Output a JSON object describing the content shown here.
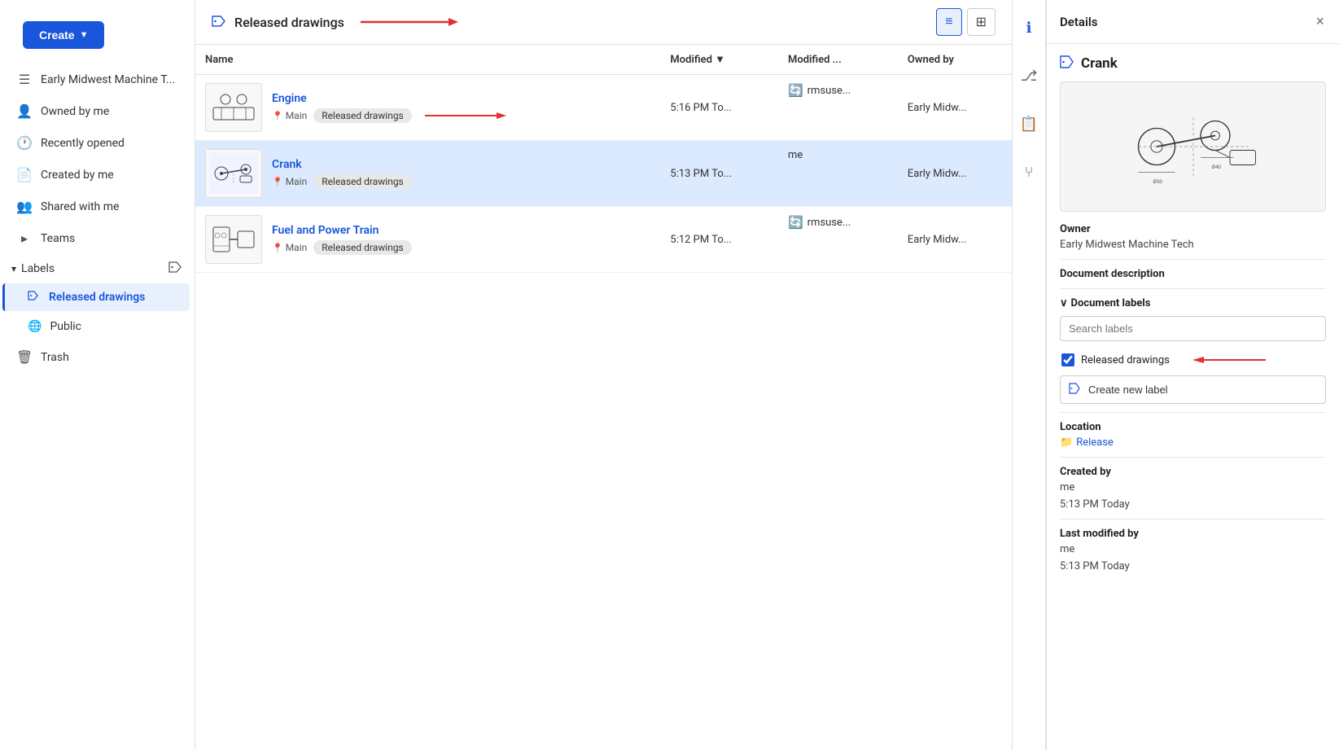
{
  "sidebar": {
    "org_name": "Early Midwest Machine T...",
    "create_btn": "Create",
    "items": [
      {
        "id": "owned-by-me",
        "label": "Owned by me",
        "icon": "👤"
      },
      {
        "id": "recently-opened",
        "label": "Recently opened",
        "icon": "🕐"
      },
      {
        "id": "created-by-me",
        "label": "Created by me",
        "icon": "📄"
      },
      {
        "id": "shared-with-me",
        "label": "Shared with me",
        "icon": "👥"
      },
      {
        "id": "teams",
        "label": "Teams",
        "icon": "👥"
      }
    ],
    "labels_header": "Labels",
    "labels_items": [
      {
        "id": "released-drawings",
        "label": "Released drawings",
        "active": true
      },
      {
        "id": "public",
        "label": "Public",
        "icon": "🌐"
      }
    ],
    "trash": "Trash"
  },
  "topbar": {
    "title": "Released drawings",
    "view_list_label": "List view",
    "view_grid_label": "Grid view"
  },
  "table": {
    "columns": {
      "name": "Name",
      "modified": "Modified",
      "modified_by": "Modified ...",
      "owned_by": "Owned by"
    },
    "rows": [
      {
        "id": "engine",
        "name": "Engine",
        "branch": "Main",
        "label": "Released drawings",
        "modified": "5:16 PM To...",
        "modified_by": "rmsuse...",
        "owned_by": "Early Midw...",
        "selected": false,
        "show_arrow": true
      },
      {
        "id": "crank",
        "name": "Crank",
        "branch": "Main",
        "label": "Released drawings",
        "modified": "5:13 PM To...",
        "modified_by": "me",
        "owned_by": "Early Midw...",
        "selected": true,
        "show_arrow": false
      },
      {
        "id": "fuel-and-power-train",
        "name": "Fuel and Power Train",
        "branch": "Main",
        "label": "Released drawings",
        "modified": "5:12 PM To...",
        "modified_by": "rmsuse...",
        "owned_by": "Early Midw...",
        "selected": false,
        "show_arrow": false
      }
    ]
  },
  "details": {
    "title": "Details",
    "doc_title": "Crank",
    "close_btn": "×",
    "owner_label": "Owner",
    "owner_value": "Early Midwest Machine Tech",
    "doc_description_label": "Document description",
    "doc_labels_label": "Document labels",
    "label_search_placeholder": "Search labels",
    "labels": [
      {
        "id": "released-drawings",
        "label": "Released drawings",
        "checked": true
      }
    ],
    "create_new_label_btn": "Create new label",
    "location_label": "Location",
    "location_value": "Release",
    "created_by_label": "Created by",
    "created_by_value": "me",
    "created_time": "5:13 PM Today",
    "last_modified_label": "Last modified by",
    "last_modified_value": "me",
    "last_modified_time": "5:13 PM Today"
  },
  "arrows": {
    "right": "→"
  }
}
